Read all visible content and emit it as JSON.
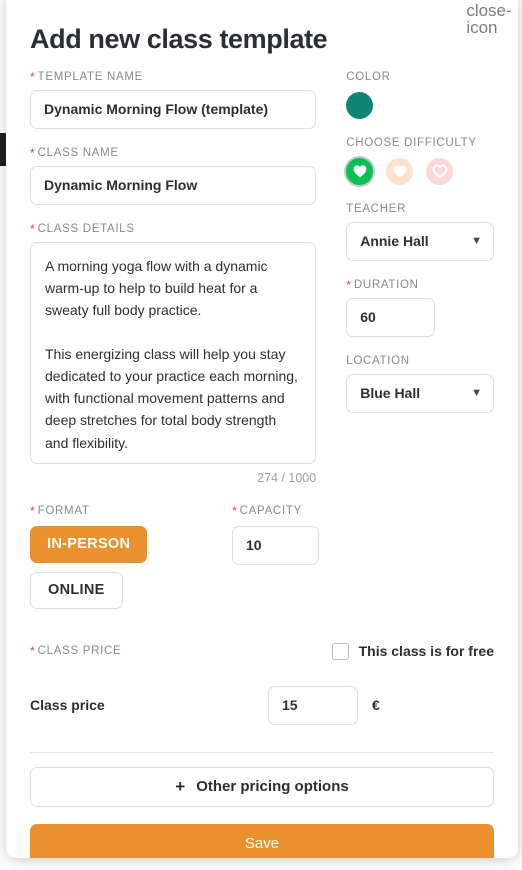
{
  "modal": {
    "title": "Add new class template",
    "close_icon": "close-icon"
  },
  "fields": {
    "template_name": {
      "label": "TEMPLATE NAME",
      "required": "*",
      "value": "Dynamic Morning Flow (template)"
    },
    "class_name": {
      "label": "CLASS NAME",
      "required": "*",
      "value": "Dynamic Morning Flow"
    },
    "class_details": {
      "label": "CLASS DETAILS",
      "required": "*",
      "value": "A morning yoga flow with a dynamic warm-up to help to build heat for a sweaty full body practice.\n\nThis energizing class will help you stay dedicated to your practice each morning, with functional movement patterns and deep stretches for total body strength and flexibility.",
      "counter": "274 / 1000"
    },
    "color": {
      "label": "COLOR",
      "value": "#0c8577"
    },
    "difficulty": {
      "label": "CHOOSE DIFFICULTY",
      "options": [
        {
          "name": "difficulty-easy",
          "circle": "#0cbf52",
          "heart": "#ffffff",
          "filled": true,
          "selected": true
        },
        {
          "name": "difficulty-medium",
          "circle": "#fde3ce",
          "heart": "#ffffff",
          "filled": true,
          "selected": false
        },
        {
          "name": "difficulty-hard",
          "circle": "#fbd7d7",
          "heart": "#ffffff",
          "filled": false,
          "selected": false
        }
      ]
    },
    "teacher": {
      "label": "TEACHER",
      "value": "Annie Hall",
      "chevron": "∨"
    },
    "duration": {
      "label": "DURATION",
      "required": "*",
      "value": "60"
    },
    "location": {
      "label": "LOCATION",
      "value": "Blue Hall",
      "chevron": "∨"
    },
    "format": {
      "label": "FORMAT",
      "required": "*",
      "options": [
        {
          "label": "IN-PERSON",
          "selected": true
        },
        {
          "label": "ONLINE",
          "selected": false
        }
      ]
    },
    "capacity": {
      "label": "CAPACITY",
      "required": "*",
      "value": "10"
    },
    "class_price": {
      "label": "CLASS PRICE",
      "required": "*",
      "free_checkbox_label": "This class is for free",
      "free_checked": false,
      "row_label": "Class price",
      "value": "15",
      "currency": "€"
    }
  },
  "actions": {
    "other_pricing_label": "Other pricing options",
    "other_pricing_plus": "+",
    "save_label": "Save"
  },
  "colors": {
    "accent_orange": "#e8912e",
    "teal": "#0c8577",
    "green": "#0cbf52",
    "required_red": "#f0402f"
  }
}
